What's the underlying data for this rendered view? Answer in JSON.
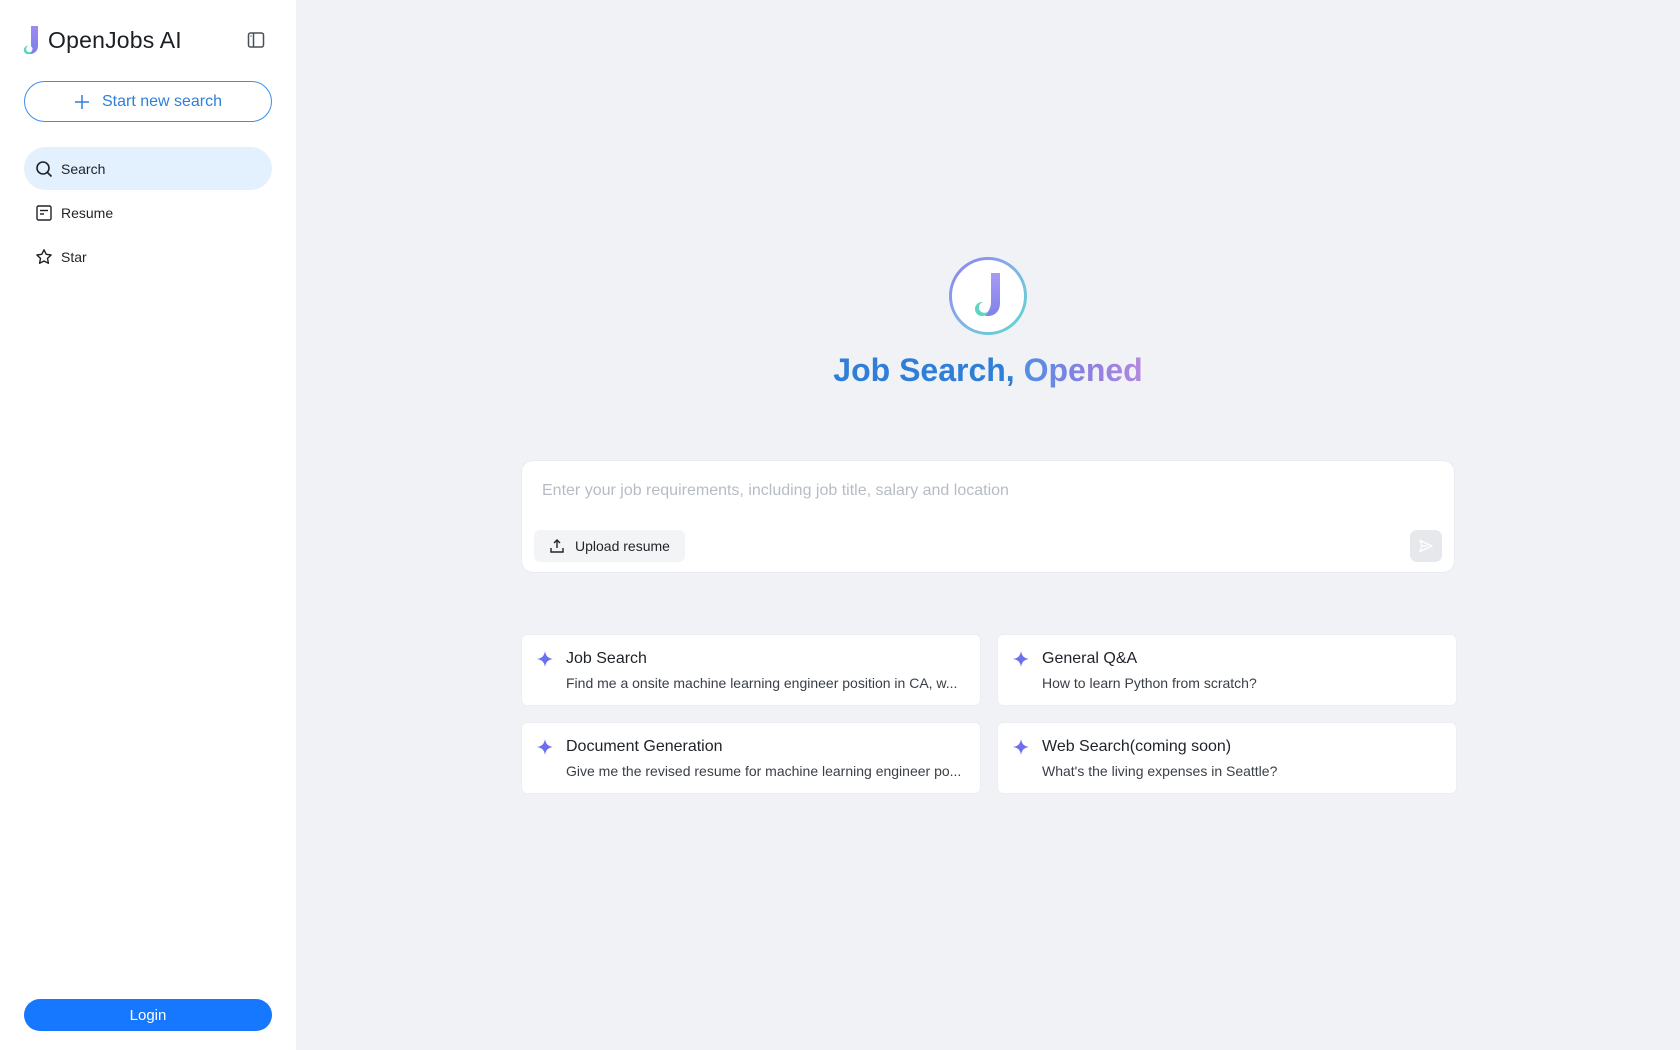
{
  "app": {
    "name": "OpenJobs AI"
  },
  "sidebar": {
    "new_search_label": "Start new search",
    "items": [
      {
        "label": "Search",
        "icon": "search-icon",
        "active": true
      },
      {
        "label": "Resume",
        "icon": "resume-icon",
        "active": false
      },
      {
        "label": "Star",
        "icon": "star-icon",
        "active": false
      }
    ],
    "login_label": "Login"
  },
  "hero": {
    "title_part1": "Job Search, ",
    "title_part2": "Opened"
  },
  "search": {
    "placeholder": "Enter your job requirements, including job title, salary and location",
    "value": "",
    "upload_label": "Upload resume"
  },
  "suggestions": [
    {
      "title": "Job Search",
      "desc": "Find me a onsite machine learning engineer position in CA, w..."
    },
    {
      "title": "General Q&A",
      "desc": "How to learn Python from scratch?"
    },
    {
      "title": "Document Generation",
      "desc": "Give me the revised resume for machine learning engineer po..."
    },
    {
      "title": "Web Search(coming soon)",
      "desc": "What's the living expenses in Seattle?"
    }
  ],
  "colors": {
    "accent": "#1677ff",
    "sidebar_active": "#e3f0fd",
    "sparkle": "#6b6ff0"
  }
}
